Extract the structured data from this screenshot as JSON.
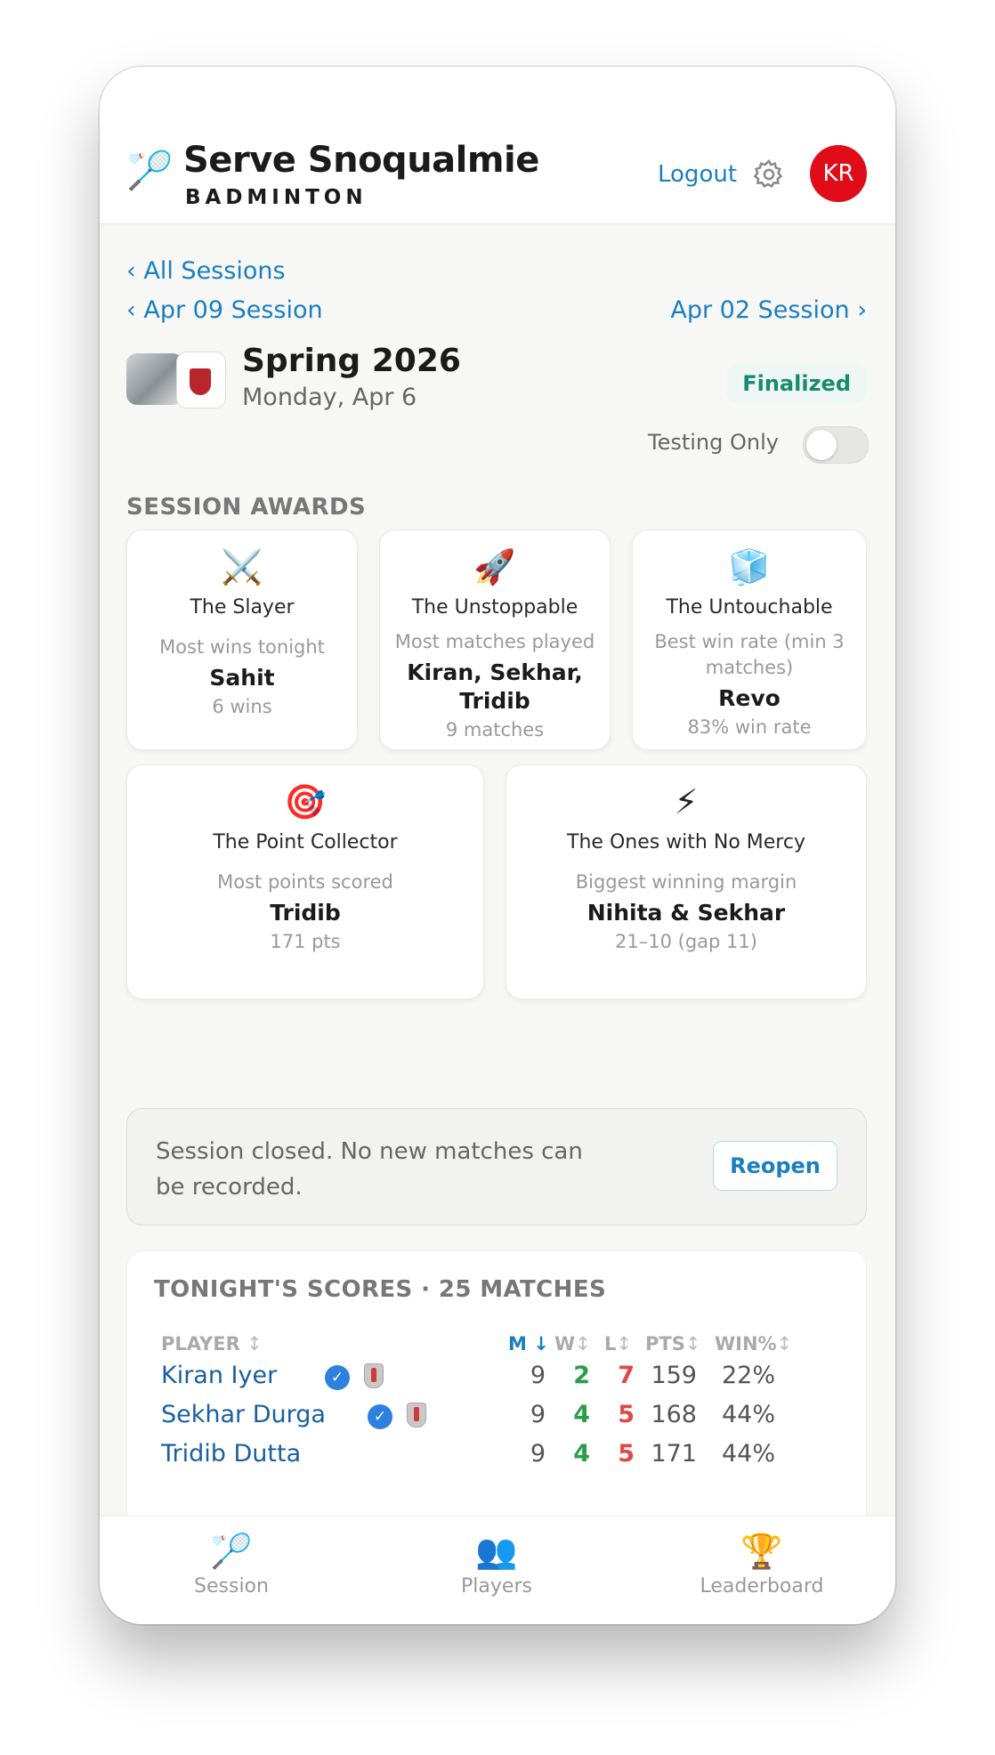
{
  "header": {
    "logo_icon": "badminton-icon",
    "title": "Serve Snoqualmie",
    "subtitle": "BADMINTON",
    "logout_label": "Logout",
    "avatar_initials": "KR",
    "avatar_color": "#e00c1a"
  },
  "nav": {
    "all_sessions": "‹ All Sessions",
    "prev_session": "‹ Apr 09 Session",
    "next_session": "Apr 02 Session ›"
  },
  "session": {
    "title": "Spring 2026",
    "date": "Monday, Apr 6",
    "status_badge": "Finalized",
    "testing_label": "Testing Only",
    "testing_enabled": false
  },
  "awards": {
    "heading": "SESSION AWARDS",
    "items": [
      {
        "icon": "⚔️",
        "name": "The Slayer",
        "desc": "Most wins tonight",
        "winner": "Sahit",
        "value": "6 wins"
      },
      {
        "icon": "🚀",
        "name": "The Unstoppable",
        "desc": "Most matches played",
        "winner": "Kiran, Sekhar, Tridib",
        "value": "9 matches"
      },
      {
        "icon": "🧊",
        "name": "The Untouchable",
        "desc": "Best win rate (min 3 matches)",
        "winner": "Revo",
        "value": "83% win rate"
      },
      {
        "icon": "🎯",
        "name": "The Point Collector",
        "desc": "Most points scored",
        "winner": "Tridib",
        "value": "171 pts"
      },
      {
        "icon": "⚡",
        "name": "The Ones with No Mercy",
        "desc": "Biggest winning margin",
        "winner": "Nihita & Sekhar",
        "value": "21–10 (gap 11)"
      }
    ]
  },
  "closed_notice": {
    "text": "Session closed. No new matches can be recorded.",
    "button": "Reopen"
  },
  "scores": {
    "heading": "TONIGHT'S SCORES · 25 MATCHES",
    "columns": {
      "player": "PLAYER",
      "m": "M",
      "w": "W",
      "l": "L",
      "pts": "PTS",
      "win": "WIN%"
    },
    "rows": [
      {
        "name": "Kiran Iyer",
        "verified": true,
        "shield": true,
        "m": "9",
        "w": "2",
        "l": "7",
        "pts": "159",
        "win": "22%"
      },
      {
        "name": "Sekhar Durga",
        "verified": true,
        "shield": true,
        "m": "9",
        "w": "4",
        "l": "5",
        "pts": "168",
        "win": "44%"
      },
      {
        "name": "Tridib Dutta",
        "verified": false,
        "shield": false,
        "m": "9",
        "w": "4",
        "l": "5",
        "pts": "171",
        "win": "44%"
      }
    ]
  },
  "tabs": [
    {
      "icon": "🏸",
      "label": "Session"
    },
    {
      "icon": "👥",
      "label": "Players"
    },
    {
      "icon": "🏆",
      "label": "Leaderboard"
    }
  ],
  "colors": {
    "accent": "#1a7fc1",
    "win": "#2a9d4a",
    "loss": "#e04848",
    "finalized": "#1a8a6d"
  }
}
